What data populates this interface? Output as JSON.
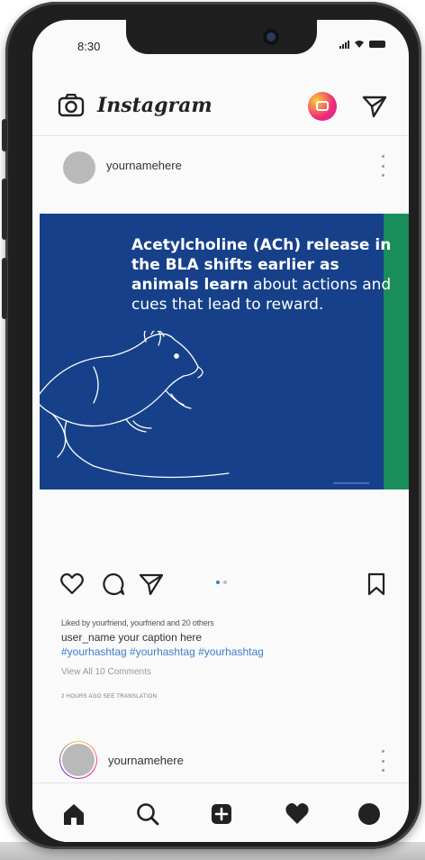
{
  "status_bar": {
    "time": "8:30"
  },
  "header": {
    "brand": "Instagram",
    "icons": [
      "camera-icon",
      "igtv-icon",
      "direct-message-icon"
    ]
  },
  "post": {
    "username": "yournamehere",
    "image": {
      "headline_bold": "Acetylcholine (ACh) release in the BLA shifts earlier as animals learn",
      "headline_regular": " about actions and cues that lead to reward.",
      "background_color": "#16418a",
      "accent_color": "#1a8e5a"
    },
    "likes_text": "Liked by  yourfriend, yourfriend        and  20 others",
    "caption": "user_name your caption here",
    "hashtags": "#yourhashtag #yourhashtag #yourhashtag",
    "view_comments": "View All 10 Comments",
    "timestamp": "2 HOURS AGO   SEE TRANSLATION"
  },
  "next_post": {
    "username": "yournamehere"
  },
  "bottom_nav": [
    "home-icon",
    "search-icon",
    "add-post-icon",
    "heart-icon",
    "profile-icon"
  ]
}
